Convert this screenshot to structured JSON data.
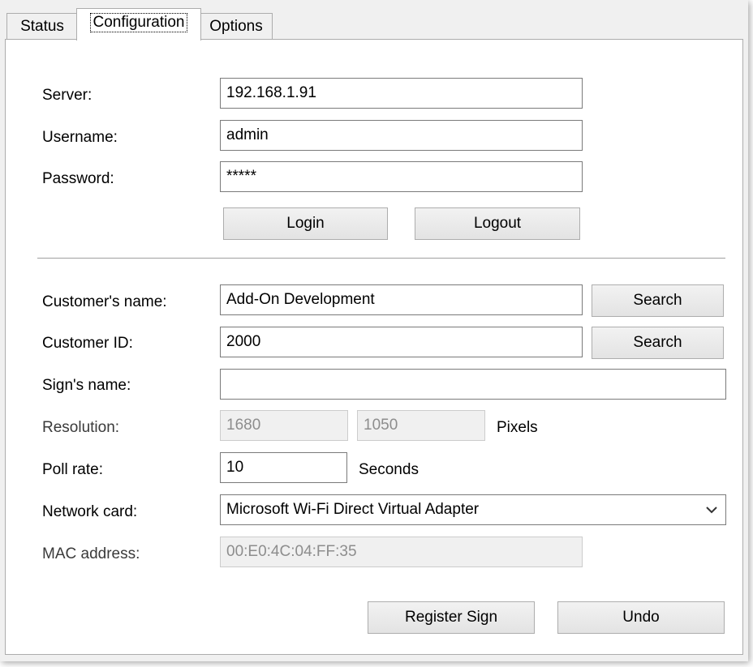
{
  "tabs": [
    {
      "label": "Status"
    },
    {
      "label": "Configuration"
    },
    {
      "label": "Options"
    }
  ],
  "server": {
    "label": "Server:",
    "value": "192.168.1.91"
  },
  "username": {
    "label": "Username:",
    "value": "admin"
  },
  "password": {
    "label": "Password:",
    "value": "*****"
  },
  "login_button": "Login",
  "logout_button": "Logout",
  "customer_name": {
    "label": "Customer's name:",
    "value": "Add-On Development",
    "search_label": "Search"
  },
  "customer_id": {
    "label": "Customer ID:",
    "value": "2000",
    "search_label": "Search"
  },
  "sign_name": {
    "label": "Sign's name:",
    "value": ""
  },
  "resolution": {
    "label": "Resolution:",
    "width": "1680",
    "height": "1050",
    "unit": "Pixels"
  },
  "poll_rate": {
    "label": "Poll rate:",
    "value": "10",
    "unit": "Seconds"
  },
  "network_card": {
    "label": "Network card:",
    "selected": "Microsoft Wi-Fi Direct Virtual Adapter",
    "icon": "chevron-down-icon"
  },
  "mac_address": {
    "label": "MAC address:",
    "value": "00:E0:4C:04:FF:35"
  },
  "register_button": "Register Sign",
  "undo_button": "Undo"
}
